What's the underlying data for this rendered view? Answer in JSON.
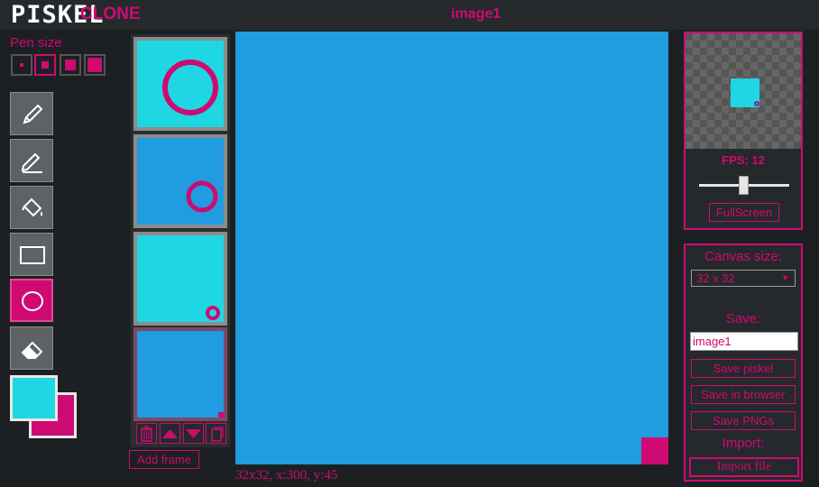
{
  "app": {
    "logo": "PISKEL",
    "logo_suffix": "CLONE",
    "document_title": "image1"
  },
  "pen_size": {
    "label": "Pen size",
    "sizes": [
      1,
      2,
      3,
      4
    ],
    "selected": 2
  },
  "tools": [
    {
      "name": "pen",
      "icon": "pencil-icon",
      "active": false
    },
    {
      "name": "stroke",
      "icon": "pen-stroke-icon",
      "active": false
    },
    {
      "name": "paint-bucket",
      "icon": "paint-bucket-icon",
      "active": false
    },
    {
      "name": "rectangle",
      "icon": "rectangle-icon",
      "active": false
    },
    {
      "name": "circle",
      "icon": "circle-icon",
      "active": true
    },
    {
      "name": "eraser",
      "icon": "eraser-icon",
      "active": false
    }
  ],
  "colors": {
    "primary": "#1fd7e2",
    "secondary": "#cf0a73",
    "accent": "#cf0a73",
    "canvas_bg": "#209ce0"
  },
  "frames": {
    "count": 4,
    "selected_index": 3,
    "add_label": "Add frame",
    "actions": [
      "trash-icon",
      "move-up-icon",
      "move-down-icon",
      "duplicate-icon"
    ]
  },
  "canvas": {
    "cursor_info": "32x32, x:300, y:45"
  },
  "preview": {
    "fps_label": "FPS: 12",
    "fps": 12,
    "fullscreen_label": "FullScreen"
  },
  "settings": {
    "canvas_size_label": "Canvas size:",
    "canvas_size_value": "32 x 32",
    "save_label": "Save:",
    "name_value": "image1",
    "save_piskel": "Save piskel",
    "save_browser": "Save in browser",
    "save_pngs": "Save PNGs",
    "import_label": "Import:",
    "import_file": "Import file"
  }
}
